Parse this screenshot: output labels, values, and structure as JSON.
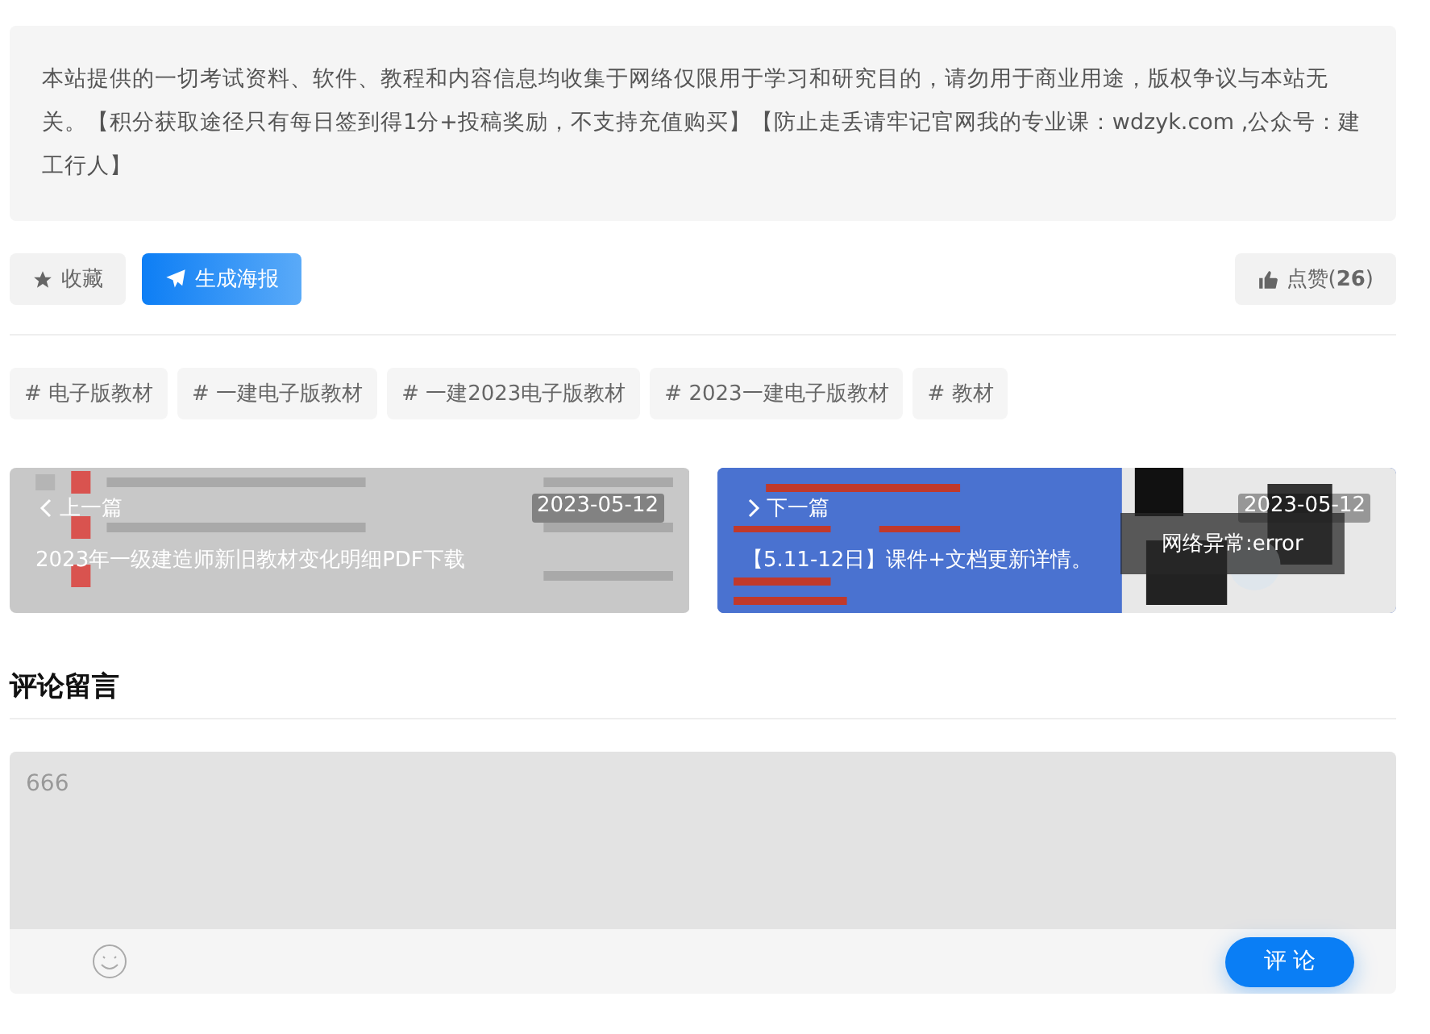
{
  "notice": "本站提供的一切考试资料、软件、教程和内容信息均收集于网络仅限用于学习和研究目的，请勿用于商业用途，版权争议与本站无关。【积分获取途径只有每日签到得1分+投稿奖励，不支持充值购买】【防止走丢请牢记官网我的专业课：wdzyk.com ,公众号：建工行人】",
  "actions": {
    "favorite": "收藏",
    "poster": "生成海报",
    "like": "点赞(**26**)"
  },
  "tags": [
    {
      "hash": "#",
      "label": "电子版教材"
    },
    {
      "hash": "#",
      "label": "一建电子版教材"
    },
    {
      "hash": "#",
      "label": "一建2023电子版教材"
    },
    {
      "hash": "#",
      "label": "2023一建电子版教材"
    },
    {
      "hash": "#",
      "label": "教材"
    }
  ],
  "nav": [
    {
      "kind": "prev",
      "label": "上一篇",
      "date": "2023-05-12",
      "title": "2023年一级建造师新旧教材变化明细PDF下载"
    },
    {
      "kind": "next",
      "label": "下一篇",
      "date": "2023-05-12",
      "title": "【5.11-12日】课件+文档更新详情。"
    }
  ],
  "toast": "网络异常:error",
  "comments": {
    "heading": "评论留言",
    "placeholder": "666",
    "submit": "评 论"
  }
}
